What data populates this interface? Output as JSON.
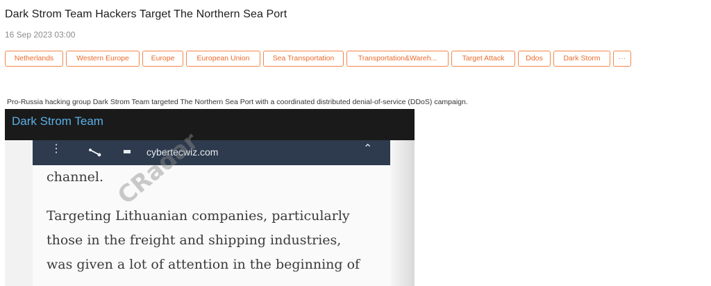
{
  "article": {
    "title": "Dark Strom Team Hackers Target The Northern Sea Port",
    "date": "16 Sep 2023 03:00",
    "tags": [
      "Netherlands",
      "Western Europe",
      "Europe",
      "European Union",
      "Sea Transportation",
      "Transportation&Wareh...",
      "Target Attack",
      "Ddos",
      "Dark Storm",
      "···"
    ],
    "summary": "Pro-Russia hacking group Dark Strom Team targeted The Northern Sea Port with a coordinated distributed denial-of-service (DDoS) campaign."
  },
  "media": {
    "channel_name": "Dark Strom Team",
    "browser_url": "cybertecwiz.com",
    "lines": [
      "channel.",
      "Targeting Lithuanian companies, particularly",
      "those in the freight and shipping industries,",
      "was given a lot of attention in the beginning of"
    ],
    "watermark": "CRadar"
  },
  "colors": {
    "tag_border": "#f0864a",
    "tag_text": "#ec6a28",
    "channel_title": "#5ab0e8"
  }
}
